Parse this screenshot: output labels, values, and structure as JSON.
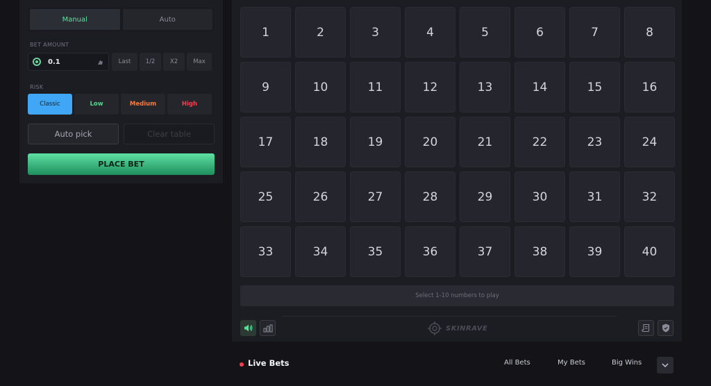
{
  "controls": {
    "mode_tabs": [
      "Manual",
      "Auto"
    ],
    "bet_amount_label": "BET AMOUNT",
    "bet_amount_value": "0.1",
    "bet_buttons": [
      "Last",
      "1/2",
      "X2",
      "Max"
    ],
    "risk_label": "RISK",
    "risk_levels": [
      "Classic",
      "Low",
      "Medium",
      "High"
    ],
    "auto_pick_label": "Auto pick",
    "clear_table_label": "Clear table",
    "place_bet_label": "PLACE BET"
  },
  "board": {
    "numbers": [
      "1",
      "2",
      "3",
      "4",
      "5",
      "6",
      "7",
      "8",
      "9",
      "10",
      "11",
      "12",
      "13",
      "14",
      "15",
      "16",
      "17",
      "18",
      "19",
      "20",
      "21",
      "22",
      "23",
      "24",
      "25",
      "26",
      "27",
      "28",
      "29",
      "30",
      "31",
      "32",
      "33",
      "34",
      "35",
      "36",
      "37",
      "38",
      "39",
      "40"
    ],
    "hint": "Select 1-10 numbers to play",
    "logo_text": "SKINRAVE"
  },
  "icons": {
    "sound": "speaker-icon",
    "stats": "bar-chart-icon",
    "rules": "scroll-icon",
    "fairness": "shield-icon"
  },
  "live_bets": {
    "title": "Live Bets",
    "tabs": [
      "All Bets",
      "My Bets",
      "Big Wins"
    ]
  },
  "colors": {
    "accent_green": "#58e29a",
    "classic_blue": "#3fa7f5",
    "low_green": "#4ed98a",
    "medium_orange": "#ff7a3a",
    "high_red": "#ff3b4e"
  }
}
